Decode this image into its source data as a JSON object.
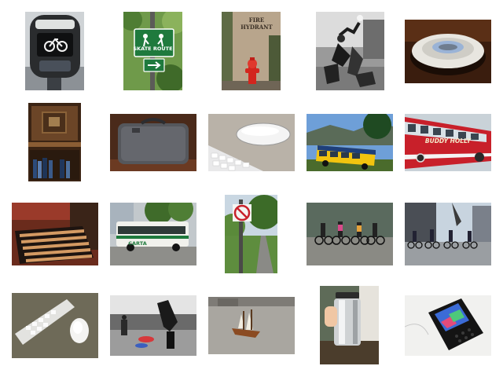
{
  "grid": {
    "rows": [
      [
        {
          "subject": "parking-meter-bicycle",
          "text": ""
        },
        {
          "subject": "skate-route-sign",
          "text": "SKATE ROUTE"
        },
        {
          "subject": "fire-hydrant-wall",
          "text": "FIRE HYDRANT"
        },
        {
          "subject": "ultimate-frisbee-players",
          "text": ""
        },
        {
          "subject": "frisbee-disc",
          "text": ""
        }
      ],
      [
        {
          "subject": "wooden-cabinet-bookshelf",
          "text": ""
        },
        {
          "subject": "gray-suitcase",
          "text": ""
        },
        {
          "subject": "keyboard-mouse",
          "text": ""
        },
        {
          "subject": "yellow-school-bus",
          "text": ""
        },
        {
          "subject": "red-bus",
          "text": "BUDDY HOLLY"
        }
      ],
      [
        {
          "subject": "wooden-bed-frame",
          "text": ""
        },
        {
          "subject": "city-bus",
          "text": "CARTA"
        },
        {
          "subject": "no-bicycles-sign",
          "text": ""
        },
        {
          "subject": "cyclists-plaza",
          "text": ""
        },
        {
          "subject": "cyclists-street",
          "text": ""
        }
      ],
      [
        {
          "subject": "white-keyboard-mouse",
          "text": ""
        },
        {
          "subject": "frisbee-catch",
          "text": ""
        },
        {
          "subject": "toy-ship",
          "text": ""
        },
        {
          "subject": "thermos-kitchen",
          "text": ""
        },
        {
          "subject": "smartphone",
          "text": ""
        }
      ]
    ]
  },
  "colors": {
    "background": "#ffffff",
    "sign_green": "#1f7a3d",
    "hydrant_red": "#d3261e",
    "bus_red": "#c8202a",
    "school_yellow": "#f2c40f"
  }
}
